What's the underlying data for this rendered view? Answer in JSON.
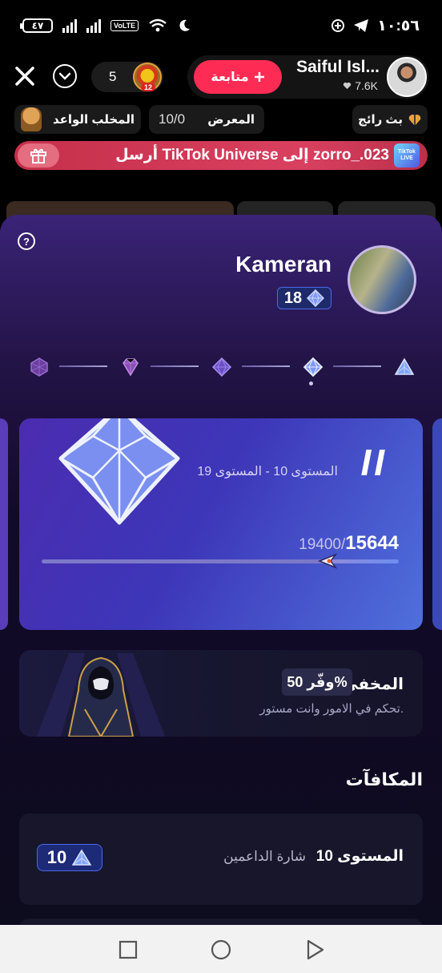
{
  "status_bar": {
    "battery": "٤٧",
    "volte": "VoLTE",
    "time": "١٠:٥٦"
  },
  "live_header": {
    "viewer_count": "5",
    "viewer_badge": "12",
    "follow_label": "متابعة",
    "host_name": "Saiful Isl...",
    "host_likes": "7.6K"
  },
  "chips": {
    "rising": "بث رائج",
    "gallery_label": "المعرض",
    "gallery_count": "10/0",
    "claw_label": "المخلب الواعد"
  },
  "gift_banner": {
    "text": "أرسل TikTok Universe إلى zorro_.023",
    "universe_label": "TikTok LIVE"
  },
  "panel": {
    "user_name": "Kameran",
    "user_level": "18",
    "tiers": [
      "tier-1",
      "tier-2",
      "tier-3",
      "tier-4",
      "tier-5"
    ],
    "active_tier_index": 1,
    "level_card": {
      "roman": "II",
      "range": "المستوى 10 - المستوى 19",
      "current_points": "15644",
      "total_points": "19400/",
      "progress_fraction": 0.806
    },
    "perk": {
      "title": "المخفي",
      "badge": "وفّر 50%",
      "description": "تحكم في الامور وانت مستور."
    },
    "rewards_title": "المكافآت",
    "reward": {
      "level": "المستوى 10",
      "name": "شارة الداعمين",
      "badge_value": "10"
    }
  },
  "colors": {
    "accent": "#fe2c55",
    "level_blue": "#4d68e8",
    "panel_top": "#3a2377",
    "panel_bottom": "#0d0b1d"
  }
}
